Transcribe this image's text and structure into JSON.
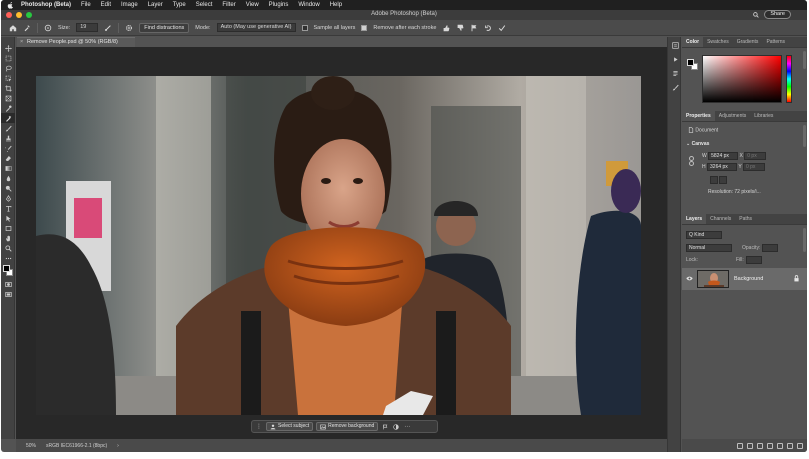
{
  "menubar": {
    "app": "Photoshop (Beta)",
    "items": [
      "File",
      "Edit",
      "Image",
      "Layer",
      "Type",
      "Select",
      "Filter",
      "View",
      "Plugins",
      "Window",
      "Help"
    ]
  },
  "titlebar": {
    "title": "Adobe Photoshop (Beta)",
    "share_label": "Share"
  },
  "options": {
    "size_label": "Size:",
    "size_value": "19",
    "find_distractions": "Find distractions",
    "mode_label": "Mode:",
    "mode_value": "Auto (May use generative AI)",
    "sample_all_layers": "Sample all layers",
    "remove_after_stroke": "Remove after each stroke"
  },
  "document": {
    "tab_title": "Remove People.psd @ 50% (RGB/8)"
  },
  "taskbar": {
    "select_subject": "Select subject",
    "remove_background": "Remove background",
    "more": "···"
  },
  "statusbar": {
    "zoom": "50%",
    "profile": "sRGB IEC61966-2.1 (8bpc)"
  },
  "color_panel": {
    "tabs": [
      "Color",
      "Swatches",
      "Gradients",
      "Patterns"
    ],
    "colors": {
      "foreground": "#000000",
      "background": "#ffffff",
      "hue": "#ff0000"
    }
  },
  "properties_panel": {
    "tabs": [
      "Properties",
      "Adjustments",
      "Libraries"
    ],
    "kind": "Document",
    "section": "Canvas",
    "w_label": "W",
    "w_value": "5824 px",
    "h_label": "H",
    "h_value": "3264 px",
    "x_label": "X",
    "y_label": "Y",
    "x_value": "0 px",
    "y_value": "0 px",
    "resolution": "Resolution: 72 pixels/i..."
  },
  "layers_panel": {
    "tabs": [
      "Layers",
      "Channels",
      "Paths"
    ],
    "filter_label": "Q Kind",
    "blend_mode": "Normal",
    "opacity_label": "Opacity:",
    "lock_label": "Lock:",
    "fill_label": "Fill:",
    "layers": [
      {
        "name": "Background"
      }
    ]
  }
}
